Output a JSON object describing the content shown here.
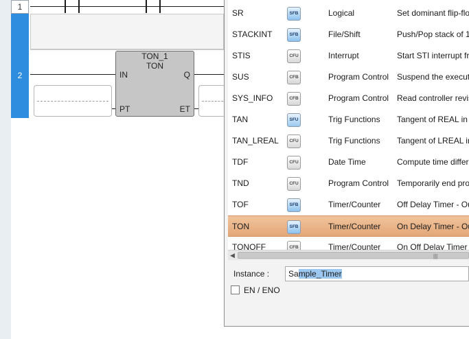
{
  "ladder": {
    "rung1_number": "1",
    "rung2_number": "2",
    "block_instance": "TON_1",
    "block_type": "TON",
    "pin_in": "IN",
    "pin_q": "Q",
    "pin_pt": "PT",
    "pin_et": "ET"
  },
  "functions": [
    {
      "name": "SR",
      "icon": "SFB",
      "category": "Logical",
      "desc": "Set dominant flip-flo"
    },
    {
      "name": "STACKINT",
      "icon": "SFB",
      "category": "File/Shift",
      "desc": "Push/Pop stack of 1."
    },
    {
      "name": "STIS",
      "icon": "CFU",
      "category": "Interrupt",
      "desc": "Start STI interrupt fr"
    },
    {
      "name": "SUS",
      "icon": "CFB",
      "category": "Program Control",
      "desc": "Suspend the executi"
    },
    {
      "name": "SYS_INFO",
      "icon": "CFB",
      "category": "Program Control",
      "desc": "Read controller revis"
    },
    {
      "name": "TAN",
      "icon": "SFU",
      "category": "Trig Functions",
      "desc": "Tangent of REAL in r"
    },
    {
      "name": "TAN_LREAL",
      "icon": "CFU",
      "category": "Trig Functions",
      "desc": "Tangent of LREAL in"
    },
    {
      "name": "TDF",
      "icon": "CFU",
      "category": "Date Time",
      "desc": "Compute time differ"
    },
    {
      "name": "TND",
      "icon": "CFU",
      "category": "Program Control",
      "desc": "Temporarily end pro"
    },
    {
      "name": "TOF",
      "icon": "SFB",
      "category": "Timer/Counter",
      "desc": "Off Delay Timer - Ou"
    },
    {
      "name": "TON",
      "icon": "SFB",
      "category": "Timer/Counter",
      "desc": "On Delay Timer - Ou",
      "selected": true
    },
    {
      "name": "TONOFF",
      "icon": "CFB",
      "category": "Timer/Counter",
      "desc": "On Off Delay Timer -"
    }
  ],
  "instance": {
    "label": "Instance :",
    "value_prefix": "Sa",
    "value_selected": "mple_Timer"
  },
  "en_eno": {
    "label": "EN / ENO",
    "checked": false
  },
  "colors": {
    "rung_bar": "#2f8de0",
    "selected_row": "#e8b084",
    "selection_highlight": "#9cc7f0"
  }
}
